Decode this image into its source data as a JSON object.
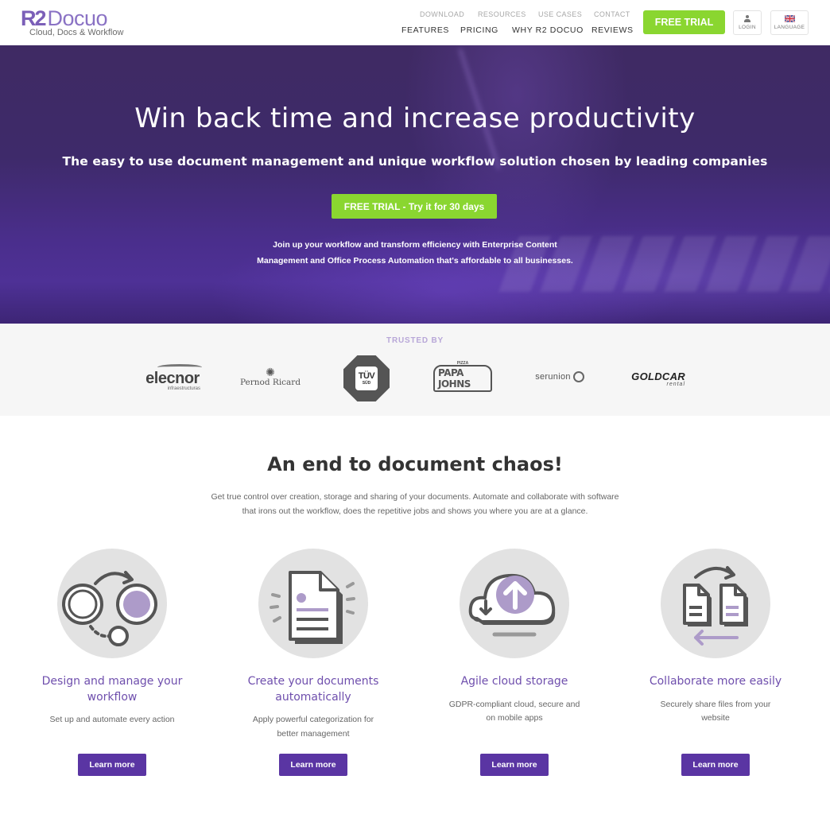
{
  "header": {
    "logo": {
      "brand_r2": "R2",
      "brand_docuo": "Docuo",
      "tagline": "Cloud, Docs & Workflow"
    },
    "nav_secondary": [
      "DOWNLOAD",
      "RESOURCES",
      "USE CASES",
      "CONTACT"
    ],
    "nav_primary": [
      "FEATURES",
      "PRICING",
      "WHY R2 DOCUO",
      "REVIEWS"
    ],
    "free_trial_label": "FREE TRIAL",
    "login_label": "LOGIN",
    "language_label": "LANGUAGE"
  },
  "hero": {
    "title": "Win back time and increase productivity",
    "subtitle": "The easy to use document management and unique workflow solution chosen by leading companies",
    "cta_label": "FREE TRIAL - Try it for 30 days",
    "text_line1": "Join up your workflow and transform efficiency with Enterprise Content",
    "text_line2": "Management and Office Process Automation that's affordable to all businesses."
  },
  "trusted": {
    "label": "TRUSTED BY",
    "logos": {
      "elecnor": {
        "name": "elecnor",
        "sub": "infraestructuras"
      },
      "pernod": {
        "name": "Pernod Ricard"
      },
      "tuv": {
        "name": "TÜV",
        "sub": "SÜD"
      },
      "papa": {
        "name": "PAPA JOHNS",
        "sub": "PIZZA"
      },
      "serunion": {
        "name": "serunion"
      },
      "goldcar": {
        "name": "GOLDCAR",
        "sub": "rental"
      }
    }
  },
  "features_section": {
    "title": "An end to document chaos!",
    "text_line1": "Get true control over creation, storage and sharing of your documents. Automate and collaborate with software",
    "text_line2": "that irons out the workflow, does the repetitive jobs and shows you where you are at a glance.",
    "items": [
      {
        "icon": "workflow-icon",
        "title": "Design and manage your workflow",
        "desc": "Set up and automate every action",
        "button": "Learn more"
      },
      {
        "icon": "document-icon",
        "title": "Create your documents automatically",
        "desc": "Apply powerful categorization for better management",
        "button": "Learn more"
      },
      {
        "icon": "cloud-upload-icon",
        "title": "Agile cloud storage",
        "desc": "GDPR-compliant cloud, secure and on mobile apps",
        "button": "Learn more"
      },
      {
        "icon": "share-files-icon",
        "title": "Collaborate more easily",
        "desc": "Securely share files from your website",
        "button": "Learn more"
      }
    ]
  },
  "colors": {
    "brand_purple": "#6f4fad",
    "button_purple": "#5a35a3",
    "cta_green": "#8ad630",
    "icon_purple": "#ad9bc9",
    "icon_gray": "#e2e2e2"
  }
}
